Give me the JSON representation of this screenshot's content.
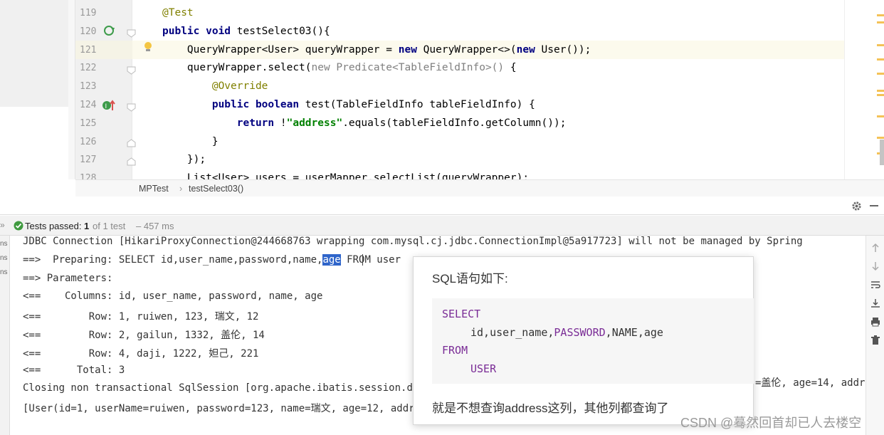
{
  "editor": {
    "lines": [
      {
        "no": "119",
        "parts": [
          {
            "t": "@Test",
            "c": "ann"
          }
        ]
      },
      {
        "no": "120",
        "parts": [
          {
            "t": "public void ",
            "c": "kw"
          },
          {
            "t": "testSelect03(){",
            "c": "fn"
          }
        ]
      },
      {
        "no": "121",
        "parts": [
          {
            "t": "    QueryWrapper<User> queryWrapper = ",
            "c": "fn"
          },
          {
            "t": "new ",
            "c": "kw"
          },
          {
            "t": "QueryWrapper<>(",
            "c": "fn"
          },
          {
            "t": "new ",
            "c": "kw"
          },
          {
            "t": "User());",
            "c": "fn"
          }
        ]
      },
      {
        "no": "122",
        "parts": [
          {
            "t": "    queryWrapper.select(",
            "c": "fn"
          },
          {
            "t": "new Predicate<TableFieldInfo>() ",
            "c": "gray"
          },
          {
            "t": "{",
            "c": "fn"
          }
        ]
      },
      {
        "no": "123",
        "parts": [
          {
            "t": "        @Override",
            "c": "ann"
          }
        ]
      },
      {
        "no": "124",
        "parts": [
          {
            "t": "        public boolean ",
            "c": "kw"
          },
          {
            "t": "test(TableFieldInfo tableFieldInfo) {",
            "c": "fn"
          }
        ]
      },
      {
        "no": "125",
        "parts": [
          {
            "t": "            return ",
            "c": "kw"
          },
          {
            "t": "!",
            "c": "fn"
          },
          {
            "t": "\"address\"",
            "c": "str"
          },
          {
            "t": ".equals(tableFieldInfo.getColumn());",
            "c": "fn"
          }
        ]
      },
      {
        "no": "126",
        "parts": [
          {
            "t": "        }",
            "c": "fn"
          }
        ]
      },
      {
        "no": "127",
        "parts": [
          {
            "t": "    });",
            "c": "fn"
          }
        ]
      },
      {
        "no": "128",
        "parts": [
          {
            "t": "    List<User> users = userMapper.selectList(queryWrapper);",
            "c": "fn"
          }
        ]
      }
    ],
    "breadcrumb": {
      "class_name": "MPTest",
      "separator": "›",
      "method_name": "testSelect03()"
    }
  },
  "run": {
    "status": {
      "prefix": "»",
      "label": "Tests passed:",
      "passed": "1",
      "of_text": "of 1 test",
      "duration": "– 457 ms"
    },
    "left_tabs": [
      "ns",
      "ns",
      "ns"
    ],
    "console": [
      "JDBC Connection [HikariProxyConnection@244668763 wrapping com.mysql.cj.jdbc.ConnectionImpl@5a917723] will not be managed by Spring",
      "==>  Preparing: SELECT id,user_name,password,name,age FROM user",
      "==> Parameters: ",
      "<==    Columns: id, user_name, password, name, age",
      "<==        Row: 1, ruiwen, 123, 瑞文, 12",
      "<==        Row: 2, gailun, 1332, 盖伦, 14",
      "<==        Row: 4, daji, 1222, 妲己, 221",
      "<==      Total: 3",
      "Closing non transactional SqlSession [org.apache.ibatis.session.de",
      "[User(id=1, userName=ruiwen, password=123, name=瑞文, age=12, addr"
    ],
    "console_tail": "=盖伦, age=14, addr",
    "highlighted_word": "age"
  },
  "tooltip": {
    "title": "SQL语句如下:",
    "code": {
      "kw1": "SELECT",
      "cols_a": "id,user_name,",
      "cols_kw": "PASSWORD",
      "cols_b": ",",
      "cols_kw2": "NAME",
      "cols_c": ",age",
      "kw2": "FROM",
      "table": "USER"
    },
    "footer": "就是不想查询address这列，其他列都查询了"
  },
  "watermark": "CSDN @蓦然回首却已人去楼空"
}
